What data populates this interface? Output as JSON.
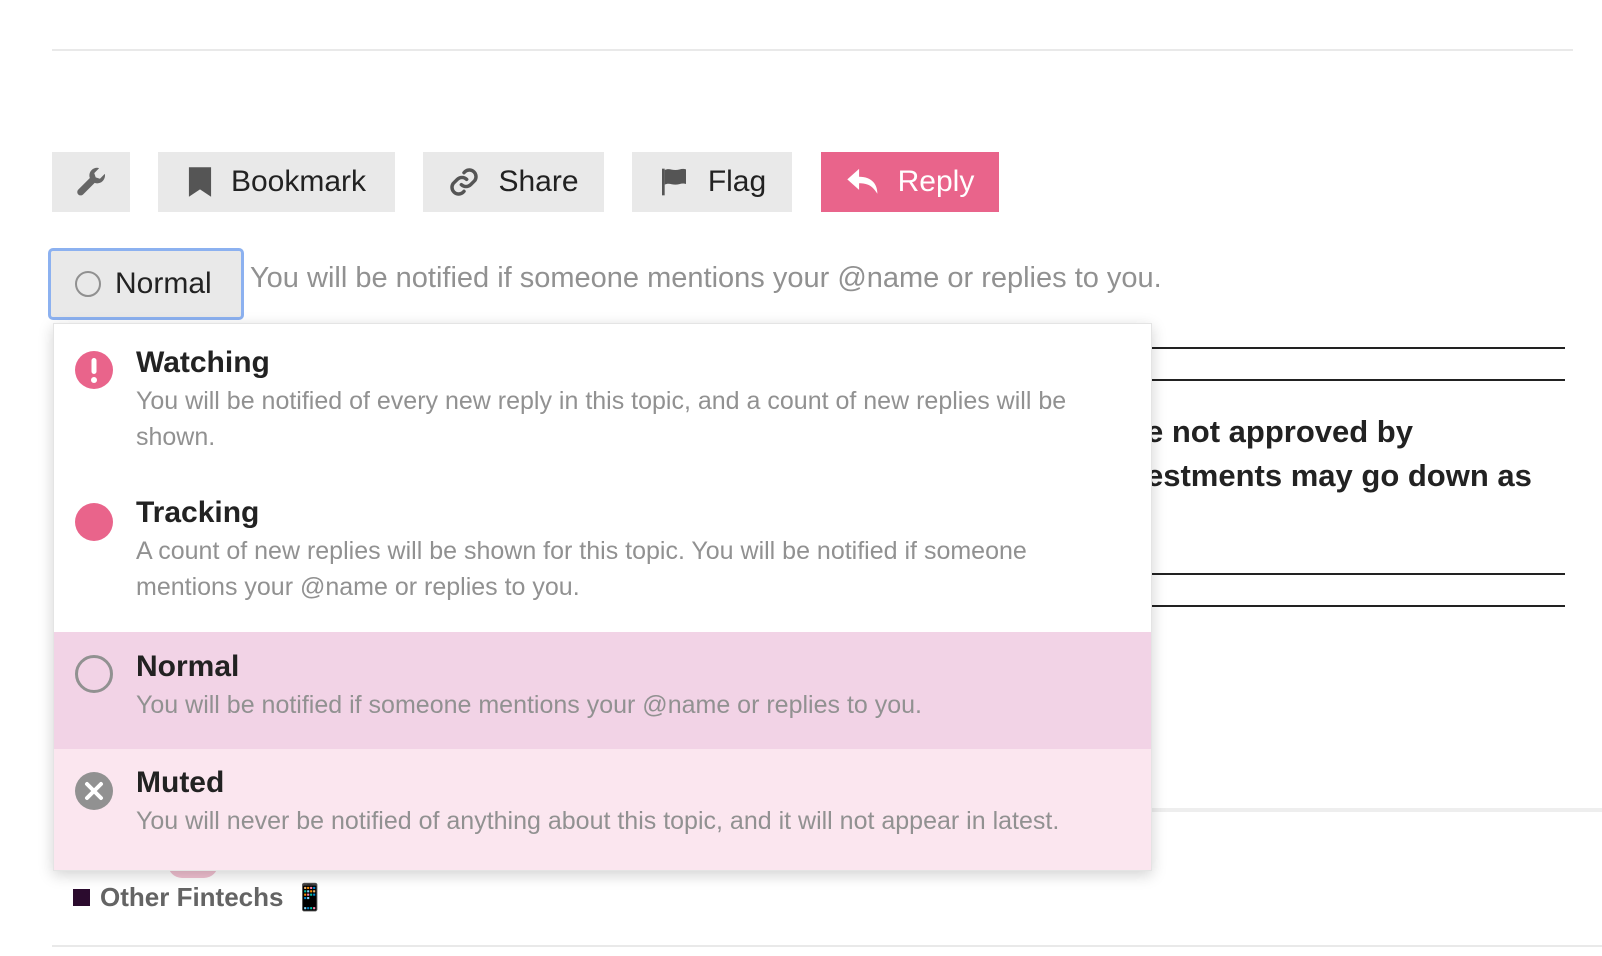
{
  "colors": {
    "accent": "#e45735",
    "reply_button": "#e9648b",
    "selected_option_bg": "#f2d3e6",
    "hover_option_bg": "#fbe6ef",
    "focus_border": "#8cb1f0"
  },
  "toolbar": {
    "admin_icon": "wrench-icon",
    "bookmark_label": "Bookmark",
    "share_label": "Share",
    "flag_label": "Flag",
    "reply_label": "Reply"
  },
  "notifications": {
    "current_level": "Normal",
    "current_description": "You will be notified if someone mentions your @name or replies to you.",
    "options": [
      {
        "icon": "exclamation-circle-icon",
        "title": "Watching",
        "description": "You will be notified of every new reply in this topic, and a count of new replies will be shown."
      },
      {
        "icon": "filled-circle-icon",
        "title": "Tracking",
        "description": "A count of new replies will be shown for this topic. You will be notified if someone mentions your @name or replies to you."
      },
      {
        "icon": "empty-circle-icon",
        "title": "Normal",
        "description": "You will be notified if someone mentions your @name or replies to you."
      },
      {
        "icon": "x-circle-icon",
        "title": "Muted",
        "description": "You will never be notified of anything about this topic, and it will not appear in latest."
      }
    ]
  },
  "background": {
    "line_1": "e not approved by",
    "line_2": "estments may go down as"
  },
  "category": {
    "label": "Other Fintechs",
    "emoji": "📱"
  }
}
